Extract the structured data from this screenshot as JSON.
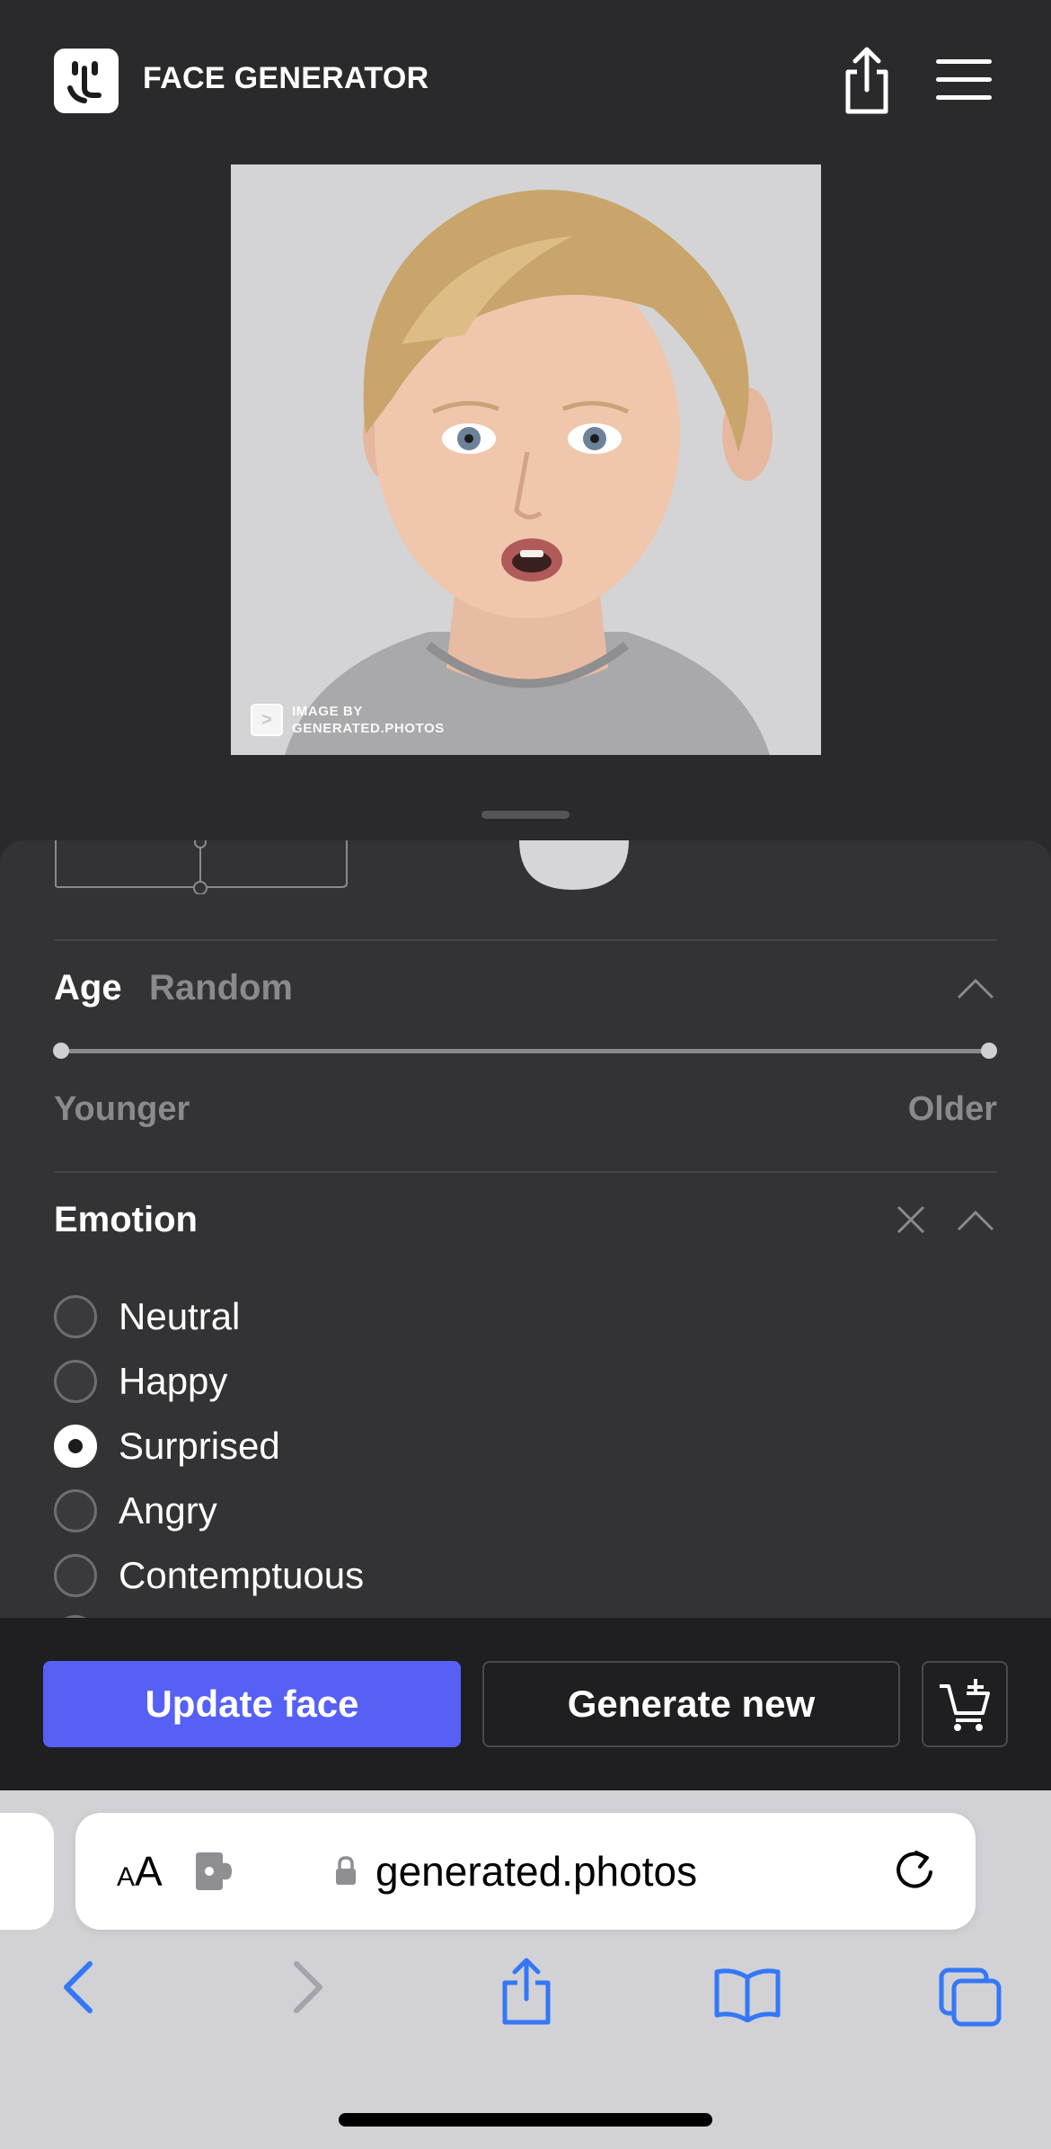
{
  "header": {
    "title": "FACE GENERATOR",
    "logo_icon": "face-logo-icon",
    "share_icon": "share-icon",
    "menu_icon": "hamburger-menu-icon"
  },
  "face_image": {
    "watermark_line1": "IMAGE BY",
    "watermark_line2": "GENERATED.PHOTOS",
    "watermark_glyph": ">"
  },
  "age": {
    "title": "Age",
    "value": "Random",
    "min_label": "Younger",
    "max_label": "Older",
    "range_min_fraction": 0.0,
    "range_max_fraction": 1.0
  },
  "emotion": {
    "title": "Emotion",
    "options": [
      {
        "label": "Neutral",
        "selected": false
      },
      {
        "label": "Happy",
        "selected": false
      },
      {
        "label": "Surprised",
        "selected": true
      },
      {
        "label": "Angry",
        "selected": false
      },
      {
        "label": "Contemptuous",
        "selected": false
      }
    ]
  },
  "actions": {
    "update_label": "Update face",
    "generate_label": "Generate new",
    "cart_icon": "cart-add-icon"
  },
  "browser": {
    "text_size_small": "A",
    "text_size_big": "A",
    "url": "generated.photos",
    "icons": [
      "back-icon",
      "forward-icon",
      "share-icon",
      "bookmarks-icon",
      "tabs-icon"
    ]
  },
  "colors": {
    "accent": "#5660f5",
    "background": "#2a2a2c",
    "panel": "#333335",
    "ios_link": "#3478f6"
  }
}
